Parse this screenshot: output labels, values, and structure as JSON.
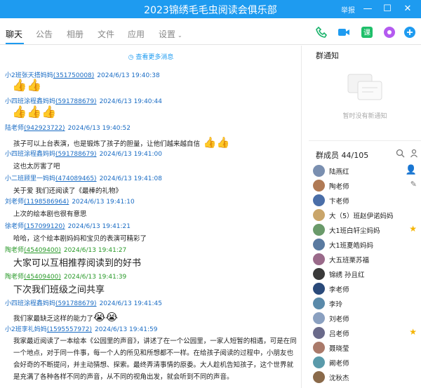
{
  "window": {
    "title": "2023锦绣毛毛虫阅读会俱乐部",
    "report_label": "举报"
  },
  "tabs": [
    "聊天",
    "公告",
    "相册",
    "文件",
    "应用",
    "设置"
  ],
  "chat": {
    "more_link": "查看更多消息",
    "messages": [
      {
        "name": "小2班张天搭妈妈",
        "id": "(351750008)",
        "time": "2024/6/13 19:40:38",
        "body": ""
      },
      {
        "name": "小四班涂程鑫妈妈",
        "id": "(591788679)",
        "time": "2024/6/13 19:40:44",
        "body": ""
      },
      {
        "name": "陆老师",
        "id": "(942923722)",
        "time": "2024/6/13 19:40:52",
        "body": "孩子可以上台表演，也是锻炼了孩子的胆量，让他们越来越自信"
      },
      {
        "name": "小四班涂程鑫妈妈",
        "id": "(591788679)",
        "time": "2024/6/13 19:41:00",
        "body": "这也太厉害了吧"
      },
      {
        "name": "小二班顾里一妈妈",
        "id": "(474089465)",
        "time": "2024/6/13 19:41:08",
        "body": "关于爱 我们还阅读了《最棒的礼物》"
      },
      {
        "name": "刘老师",
        "id": "(1198586964)",
        "time": "2024/6/13 19:41:10",
        "body": "上次的绘本剧也很有意思"
      },
      {
        "name": "徐老师",
        "id": "(157099120)",
        "time": "2024/6/13 19:41:21",
        "body": "哈哈，这个绘本剧妈妈和宝贝的表演可精彩了"
      },
      {
        "name": "陶老师",
        "id": "(45409400)",
        "time": "2024/6/13 19:41:27",
        "body": "大家可以互相推荐阅读到的好书"
      },
      {
        "name": "陶老师",
        "id": "(45409400)",
        "time": "2024/6/13 19:41:39",
        "body": "下次我们班级之间共享"
      },
      {
        "name": "小四班涂程鑫妈妈",
        "id": "(591788679)",
        "time": "2024/6/13 19:41:45",
        "body": "我们家最缺乏这样的能力了"
      },
      {
        "name": "小2班李礼妈妈",
        "id": "(1595557972)",
        "time": "2024/6/13 19:41:59",
        "body": "我家最近阅读了一本绘本《公园里的声音》，讲述了在一个公园里，一家人短暂的相遇，可是在同一个地点，对于同一件事，每一个人的所见和所想都不一样。在给孩子阅读的过程中，小朋友也会好奇的不断提问，并主动猜想、探索。最终弄清事情的原委。大人趁机告知孩子，这个世界就是充满了各种各样不同的声音，从不同的视角出发，就会听到不同的声音。"
      }
    ]
  },
  "notice": {
    "title": "群通知",
    "empty": "暂时没有新通知"
  },
  "members": {
    "title": "群成员 44/105",
    "list": [
      {
        "name": "陆燕红",
        "color": "#7a8fb0",
        "star": false,
        "owner": true
      },
      {
        "name": "陶老师",
        "color": "#b07a55",
        "star": false,
        "owner": false
      },
      {
        "name": "卞老师",
        "color": "#4a6ea8",
        "star": false,
        "owner": false
      },
      {
        "name": "大（5）班赵伊诺妈妈",
        "color": "#c9a56a",
        "star": false,
        "owner": false
      },
      {
        "name": "大1班白轩尘妈妈",
        "color": "#6a9a6a",
        "star": true,
        "owner": false
      },
      {
        "name": "大1班夏皓妈妈",
        "color": "#5a7aa0",
        "star": false,
        "owner": false
      },
      {
        "name": "大五班栗苏福",
        "color": "#9a6a8a",
        "star": false,
        "owner": false
      },
      {
        "name": "锦绣  孙且红",
        "color": "#3a3a3a",
        "star": false,
        "owner": false
      },
      {
        "name": "李老师",
        "color": "#2a4a7a",
        "star": false,
        "owner": false
      },
      {
        "name": "李玲",
        "color": "#5a8aaa",
        "star": false,
        "owner": false
      },
      {
        "name": "刘老师",
        "color": "#8aa0c0",
        "star": false,
        "owner": false
      },
      {
        "name": "吕老师",
        "color": "#6a6a8a",
        "star": true,
        "owner": false
      },
      {
        "name": "聂晓莹",
        "color": "#aa7a6a",
        "star": false,
        "owner": false
      },
      {
        "name": "阚老师",
        "color": "#5a9aaa",
        "star": false,
        "owner": false
      },
      {
        "name": "沈秋杰",
        "color": "#8a6a4a",
        "star": false,
        "owner": false
      }
    ]
  },
  "colors": {
    "accent": "#1e9bf0",
    "link": "#1a6cc4",
    "green_name": "#2a9a2a"
  },
  "icons": [
    "minimize-icon",
    "maximize-icon",
    "close-icon",
    "phone-icon",
    "video-icon",
    "class-icon",
    "app-icon",
    "add-icon",
    "search-icon",
    "edit-icon",
    "thumbs-up-icon",
    "crying-icon"
  ]
}
